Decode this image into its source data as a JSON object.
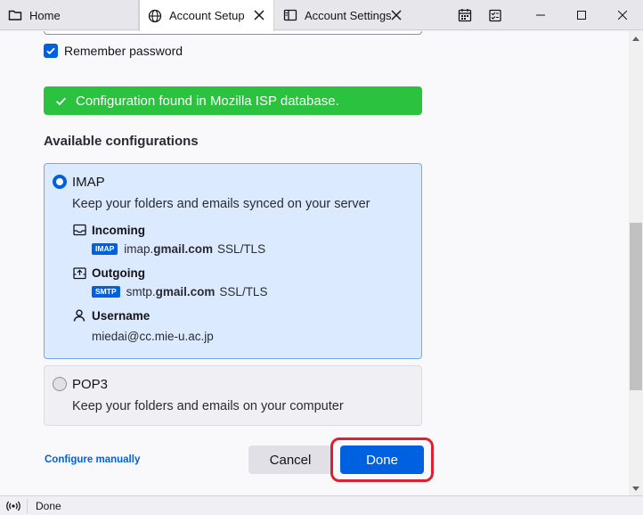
{
  "tabs": [
    {
      "label": "Home",
      "icon": "folder-icon"
    },
    {
      "label": "Account Setup",
      "icon": "globe-icon",
      "active": true
    },
    {
      "label": "Account Settings",
      "icon": "settings-page-icon"
    }
  ],
  "toolbar_icons": [
    "calendar-icon",
    "tasks-icon"
  ],
  "window_controls": [
    "minimize",
    "maximize",
    "close"
  ],
  "form": {
    "remember_password_label": "Remember password",
    "remember_password_checked": true
  },
  "notification": {
    "text": "Configuration found in Mozilla ISP database.",
    "color": "#2ac23e"
  },
  "available": {
    "title": "Available configurations",
    "imap": {
      "name": "IMAP",
      "selected": true,
      "description": "Keep your folders and emails synced on your server",
      "incoming": {
        "label": "Incoming",
        "badge": "IMAP",
        "host_prefix": "imap.",
        "host_domain": "gmail.com",
        "security": "SSL/TLS"
      },
      "outgoing": {
        "label": "Outgoing",
        "badge": "SMTP",
        "host_prefix": "smtp.",
        "host_domain": "gmail.com",
        "security": "SSL/TLS"
      },
      "username": {
        "label": "Username",
        "value": "miedai@cc.mie-u.ac.jp"
      }
    },
    "pop3": {
      "name": "POP3",
      "selected": false,
      "description": "Keep your folders and emails on your computer"
    }
  },
  "actions": {
    "configure_manually": "Configure manually",
    "cancel": "Cancel",
    "done": "Done"
  },
  "status": {
    "text": "Done"
  },
  "colors": {
    "accent": "#0061e0",
    "selected_bg": "#dbeafe",
    "highlight": "#e0202f"
  }
}
